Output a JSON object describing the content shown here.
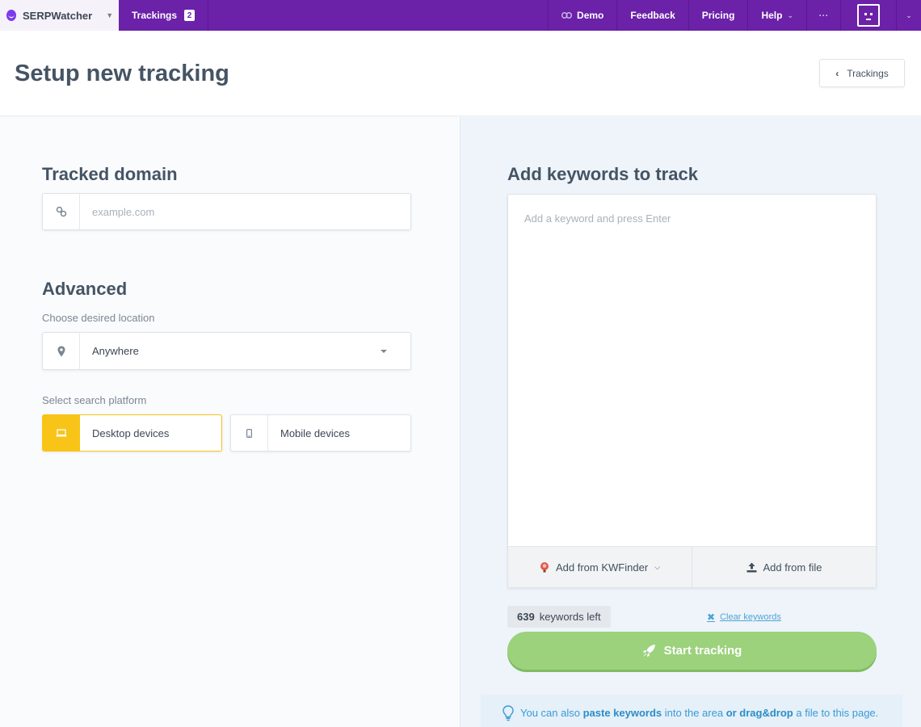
{
  "topbar": {
    "brand": "SERPWatcher",
    "trackings_label": "Trackings",
    "trackings_count": "2",
    "nav": [
      {
        "label": "Demo",
        "icon": "link-icon"
      },
      {
        "label": "Feedback"
      },
      {
        "label": "Pricing"
      },
      {
        "label": "Help",
        "icon": "chevron-down-icon"
      }
    ],
    "more_icon": "ellipsis-icon",
    "avatar_icon": "robot-avatar-icon"
  },
  "header": {
    "title": "Setup new tracking",
    "back_label": "Trackings"
  },
  "domain": {
    "heading": "Tracked domain",
    "placeholder": "example.com",
    "icon": "link-icon"
  },
  "advanced": {
    "heading": "Advanced",
    "location_label": "Choose desired location",
    "location_value": "Anywhere",
    "location_icon": "map-pin-icon",
    "platform_label": "Select search platform",
    "platforms": [
      {
        "label": "Desktop devices",
        "icon": "laptop-icon",
        "selected": true
      },
      {
        "label": "Mobile devices",
        "icon": "mobile-icon",
        "selected": false
      }
    ]
  },
  "keywords": {
    "heading": "Add keywords to track",
    "placeholder": "Add a keyword and press Enter",
    "add_from_kwfinder": "Add from KWFinder",
    "add_from_file": "Add from file",
    "count": "639",
    "count_label": "keywords left",
    "clear_label": "Clear keywords",
    "start_label": "Start tracking"
  },
  "hint": {
    "part1": "You can also",
    "bold1": "paste keywords",
    "part2": "into the area",
    "bold2": "or drag&drop",
    "part3": "a file to this page."
  },
  "colors": {
    "brand_purple": "#6b21a8",
    "accent_yellow": "#f8c417",
    "start_green": "#9bd27b",
    "link_blue": "#4fa3d6"
  }
}
